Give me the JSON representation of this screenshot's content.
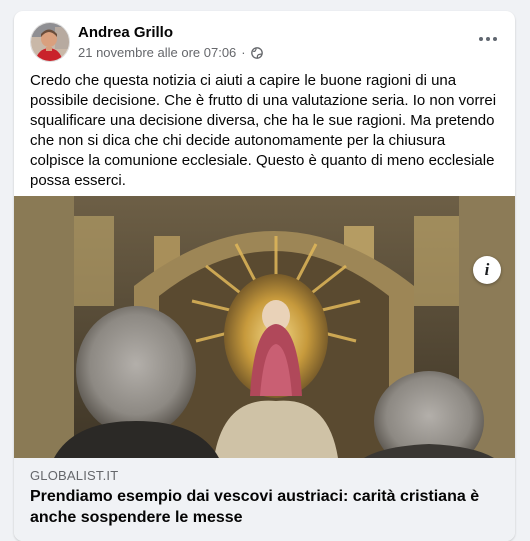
{
  "post": {
    "author": "Andrea Grillo",
    "timestamp": "21 novembre alle ore 07:06",
    "separator": "·",
    "audience_icon": "globe-icon",
    "more_icon": "more-options-icon",
    "text": "Credo che questa notizia ci aiuti a capire le buone ragioni di una possibile decisione. Che è frutto di una valutazione seria. Io non vorrei squalificare una decisione diversa, che ha le sue ragioni. Ma pretendo che non si dica che chi decide autonomamente per la chiusura colpisce la comunione ecclesiale. Questo è quanto di meno ecclesiale possa esserci."
  },
  "link": {
    "domain": "GLOBALIST.IT",
    "headline": "Prendiamo esempio dai vescovi austriaci: carità cristiana è anche sospendere le messe",
    "info_label": "i"
  },
  "colors": {
    "page_bg": "#f0f2f5",
    "card_bg": "#ffffff",
    "secondary_text": "#65676b",
    "primary_text": "#050505"
  }
}
